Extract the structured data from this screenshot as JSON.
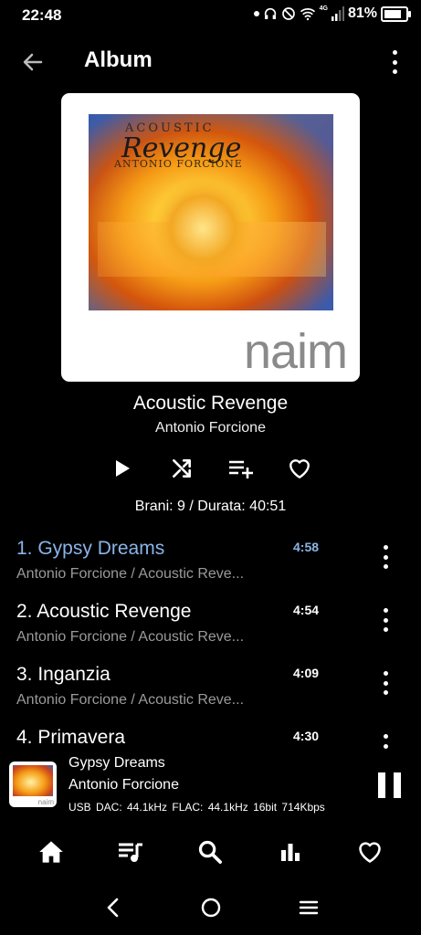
{
  "status_bar": {
    "time": "22:48",
    "network": "4G",
    "battery": "81%",
    "battery_level": 0.81
  },
  "header": {
    "title": "Album"
  },
  "cover": {
    "art_title": "ACOUSTIC",
    "art_script": "Revenge",
    "art_artist": "ANTONIO FORCIONE",
    "brand": "naim"
  },
  "album": {
    "name": "Acoustic Revenge",
    "artist": "Antonio Forcione",
    "meta": "Brani: 9 / Durata: 40:51"
  },
  "tracks": [
    {
      "title": "1. Gypsy Dreams",
      "subtitle": "Antonio Forcione / Acoustic Reve...",
      "duration": "4:58",
      "active": true
    },
    {
      "title": "2. Acoustic Revenge",
      "subtitle": "Antonio Forcione / Acoustic Reve...",
      "duration": "4:54",
      "active": false
    },
    {
      "title": "3. Inganzia",
      "subtitle": "Antonio Forcione / Acoustic Reve...",
      "duration": "4:09",
      "active": false
    },
    {
      "title": "4. Primavera",
      "subtitle": "",
      "duration": "4:30",
      "active": false
    }
  ],
  "now_playing": {
    "title": "Gypsy Dreams",
    "artist": "Antonio Forcione",
    "tech": "USB DAC: 44.1kHz  FLAC: 44.1kHz  16bit  714Kbps",
    "thumb_brand": "naim"
  },
  "icons": {
    "actions": [
      "play-icon",
      "shuffle-icon",
      "add-to-queue-icon",
      "favorite-icon"
    ],
    "nav": [
      "home-icon",
      "queue-icon",
      "search-icon",
      "equalizer-icon",
      "favorites-icon"
    ],
    "system": [
      "system-back-icon",
      "system-home-icon",
      "system-menu-icon"
    ]
  },
  "colors": {
    "accent": "#8ab4e8",
    "background": "#000000",
    "secondary_text": "#9a9a9a"
  }
}
